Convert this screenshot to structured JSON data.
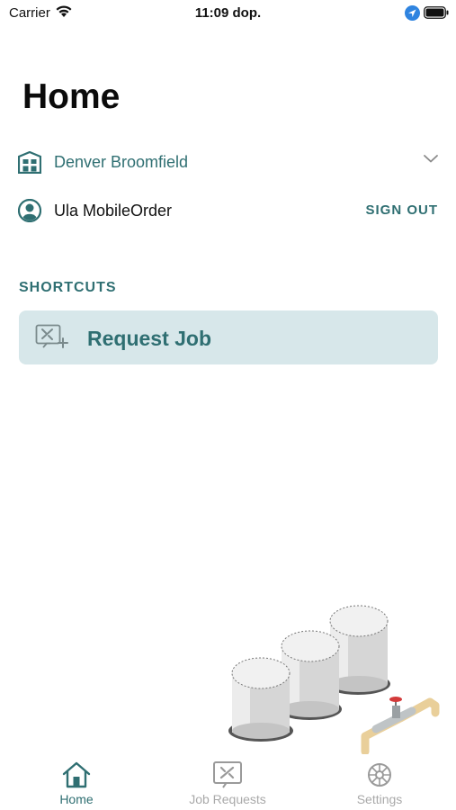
{
  "status_bar": {
    "carrier": "Carrier",
    "time": "11:09 dop."
  },
  "page": {
    "title": "Home"
  },
  "site": {
    "name": "Denver Broomfield",
    "icon": "building-icon"
  },
  "user": {
    "name": "Ula MobileOrder",
    "icon": "user-avatar-icon",
    "sign_out_label": "SIGN OUT"
  },
  "shortcuts": {
    "heading": "SHORTCUTS",
    "items": [
      {
        "label": "Request Job",
        "icon": "request-job-icon"
      }
    ]
  },
  "tab_bar": {
    "tabs": [
      {
        "label": "Home",
        "icon": "home-icon",
        "active": true
      },
      {
        "label": "Job Requests",
        "icon": "job-requests-icon",
        "active": false
      },
      {
        "label": "Settings",
        "icon": "settings-icon",
        "active": false
      }
    ]
  },
  "colors": {
    "accent": "#2f6f72",
    "shortcut_background": "#d7e7ea",
    "inactive_tab": "#a9a9a9"
  }
}
